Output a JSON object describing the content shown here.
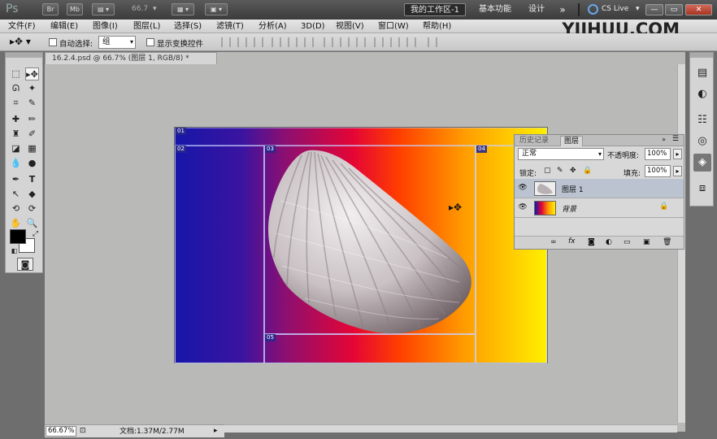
{
  "titlebar": {
    "ps_logo": "Ps",
    "icon_labels": [
      "Br",
      "Mb"
    ],
    "zoom_value": "66.7",
    "workspaces": [
      "我的工作区-1",
      "基本功能",
      "设计",
      "»"
    ],
    "cslive": "CS Live",
    "window_buttons": [
      "—",
      "▭",
      "✕"
    ]
  },
  "menubar": {
    "items": [
      "文件(F)",
      "编辑(E)",
      "图像(I)",
      "图层(L)",
      "选择(S)",
      "滤镜(T)",
      "分析(A)",
      "3D(D)",
      "视图(V)",
      "窗口(W)",
      "帮助(H)"
    ],
    "brand": "YIIHUU.COM"
  },
  "options": {
    "auto_select_label": "自动选择:",
    "auto_select_value": "组",
    "show_transform_label": "显示变换控件"
  },
  "document": {
    "tab_title": "16.2.4.psd @ 66.7% (图层 1, RGB/8) *",
    "slices": [
      "01",
      "02",
      "03",
      "04",
      "05"
    ]
  },
  "layers_panel": {
    "tabs": [
      "历史记录",
      "图层"
    ],
    "blend_mode": "正常",
    "opacity_label": "不透明度:",
    "opacity_value": "100%",
    "lock_label": "锁定:",
    "fill_label": "填充:",
    "fill_value": "100%",
    "layers": [
      {
        "name": "图层 1"
      },
      {
        "name": "背景"
      }
    ]
  },
  "statusbar": {
    "zoom": "66.67%",
    "doc_info": "文档:1.37M/2.77M"
  },
  "colors": {
    "foreground": "#000000",
    "background": "#ffffff",
    "workspace_bg": "#b9bab8",
    "active_workspace": "#2a2a2a"
  }
}
